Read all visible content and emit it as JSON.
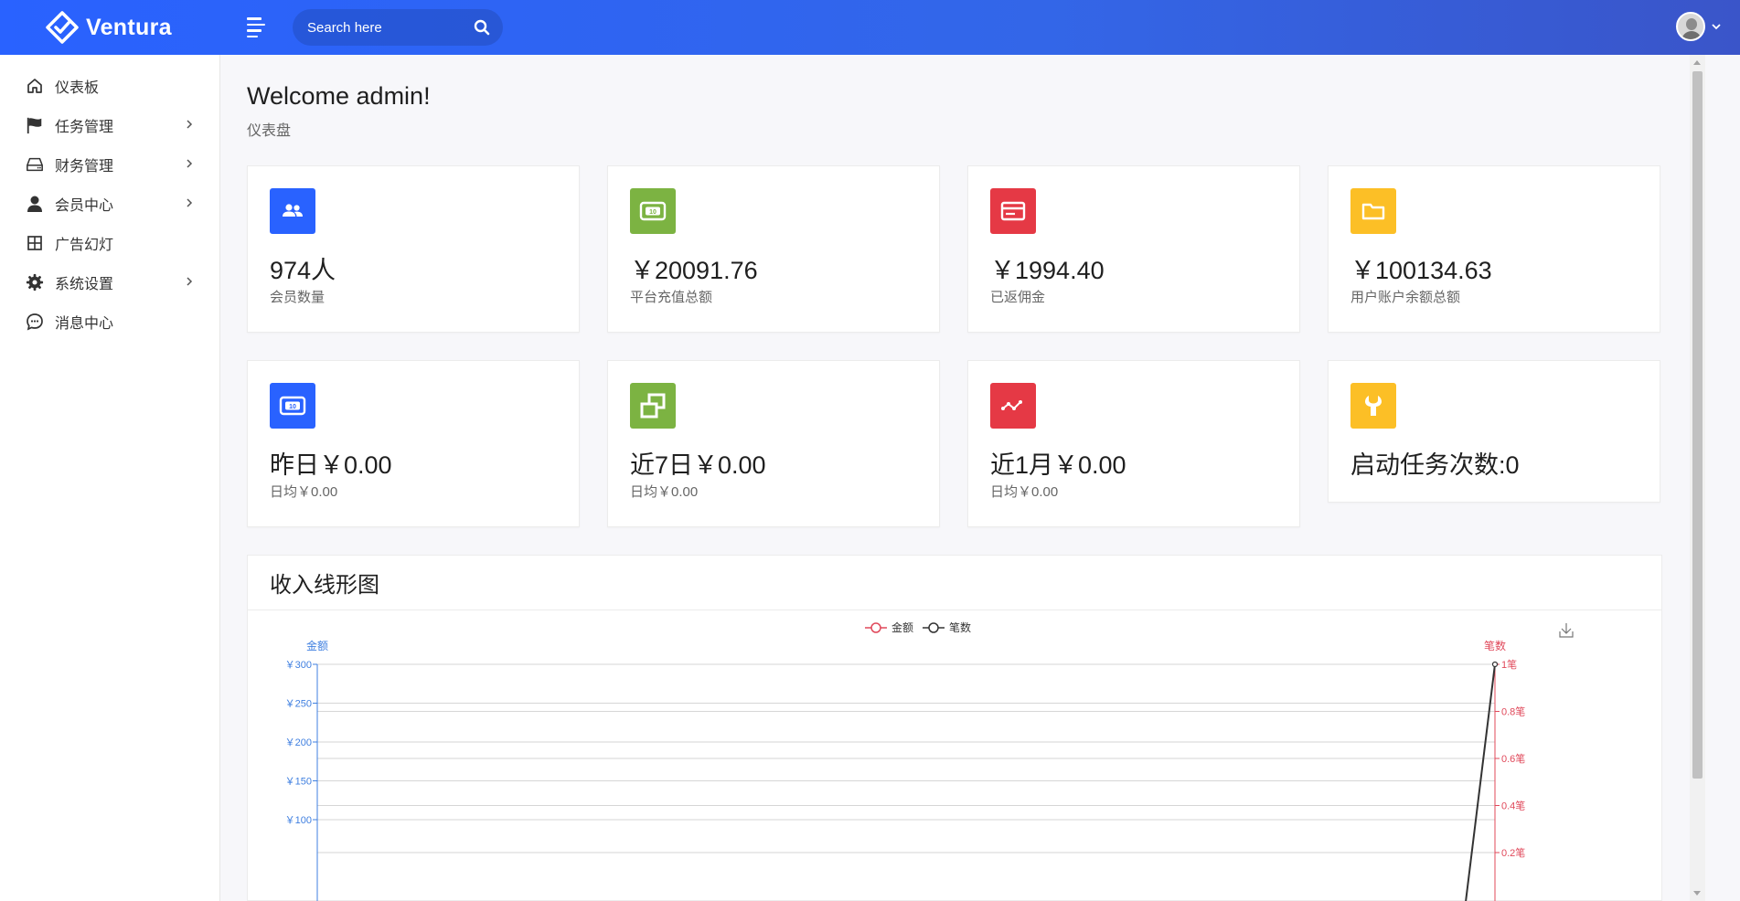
{
  "header": {
    "brand": "Ventura",
    "search_placeholder": "Search here"
  },
  "sidebar": {
    "items": [
      {
        "label": "仪表板",
        "icon": "home-icon",
        "has_children": false
      },
      {
        "label": "任务管理",
        "icon": "flag-icon",
        "has_children": true
      },
      {
        "label": "财务管理",
        "icon": "drive-icon",
        "has_children": true
      },
      {
        "label": "会员中心",
        "icon": "user-icon",
        "has_children": true
      },
      {
        "label": "广告幻灯",
        "icon": "grid-icon",
        "has_children": false
      },
      {
        "label": "系统设置",
        "icon": "gear-icon",
        "has_children": true
      },
      {
        "label": "消息中心",
        "icon": "chat-icon",
        "has_children": false
      }
    ]
  },
  "page": {
    "title": "Welcome admin!",
    "subtitle": "仪表盘"
  },
  "stats": [
    {
      "value": "974人",
      "label": "会员数量",
      "icon": "users-icon",
      "color": "#2962ff"
    },
    {
      "value": "￥20091.76",
      "label": "平台充值总额",
      "icon": "money-icon",
      "color": "#7cb342"
    },
    {
      "value": "￥1994.40",
      "label": "已返佣金",
      "icon": "card-icon",
      "color": "#e53945"
    },
    {
      "value": "￥100134.63",
      "label": "用户账户余额总额",
      "icon": "folder-icon",
      "color": "#fcbf26"
    },
    {
      "value": "昨日￥0.00",
      "label": "日均￥0.00",
      "icon": "money-icon",
      "color": "#2962ff"
    },
    {
      "value": "近7日￥0.00",
      "label": "日均￥0.00",
      "icon": "clone-icon",
      "color": "#7cb342"
    },
    {
      "value": "近1月￥0.00",
      "label": "日均￥0.00",
      "icon": "activity-icon",
      "color": "#e53945"
    },
    {
      "value": "启动任务次数:0",
      "label": "",
      "icon": "wrench-icon",
      "color": "#fcbf26"
    }
  ],
  "chart_card": {
    "title": "收入线形图"
  },
  "chart_data": {
    "type": "line",
    "legend": [
      "金额",
      "笔数"
    ],
    "legend_position": "top-center",
    "left_axis": {
      "name": "金额",
      "ticks": [
        "￥300",
        "￥250",
        "￥200",
        "￥150",
        "￥100"
      ],
      "color": "#3f7fe0"
    },
    "right_axis": {
      "name": "笔数",
      "ticks": [
        "1笔",
        "0.8笔",
        "0.6笔",
        "0.4笔",
        "0.2笔"
      ],
      "color": "#e0485a"
    },
    "ylim_left": [
      0,
      300
    ],
    "ylim_right": [
      0,
      1
    ],
    "series": [
      {
        "name": "笔数",
        "axis": "right",
        "color": "#333333",
        "last_value": 1
      }
    ],
    "grid": true
  }
}
